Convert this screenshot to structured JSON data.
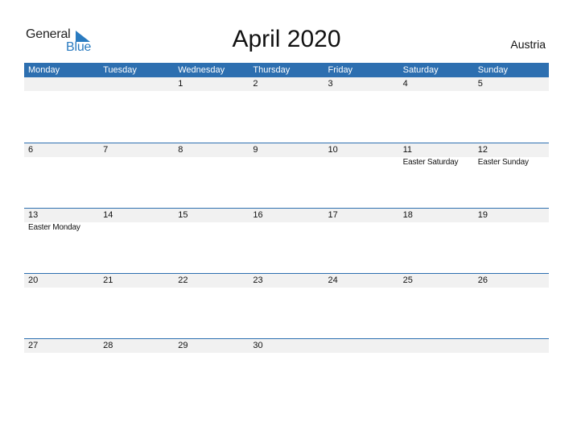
{
  "logo": {
    "general": "General",
    "blue": "Blue",
    "brand_color": "#2a7bc0"
  },
  "title": "April 2020",
  "country": "Austria",
  "header_color": "#2d6fb0",
  "weekdays": [
    "Monday",
    "Tuesday",
    "Wednesday",
    "Thursday",
    "Friday",
    "Saturday",
    "Sunday"
  ],
  "weeks": [
    {
      "days": [
        "",
        "",
        "1",
        "2",
        "3",
        "4",
        "5"
      ],
      "events": [
        "",
        "",
        "",
        "",
        "",
        "",
        ""
      ]
    },
    {
      "days": [
        "6",
        "7",
        "8",
        "9",
        "10",
        "11",
        "12"
      ],
      "events": [
        "",
        "",
        "",
        "",
        "",
        "Easter Saturday",
        "Easter Sunday"
      ]
    },
    {
      "days": [
        "13",
        "14",
        "15",
        "16",
        "17",
        "18",
        "19"
      ],
      "events": [
        "Easter Monday",
        "",
        "",
        "",
        "",
        "",
        ""
      ]
    },
    {
      "days": [
        "20",
        "21",
        "22",
        "23",
        "24",
        "25",
        "26"
      ],
      "events": [
        "",
        "",
        "",
        "",
        "",
        "",
        ""
      ]
    },
    {
      "days": [
        "27",
        "28",
        "29",
        "30",
        "",
        "",
        ""
      ],
      "events": [
        "",
        "",
        "",
        "",
        "",
        "",
        ""
      ]
    }
  ]
}
